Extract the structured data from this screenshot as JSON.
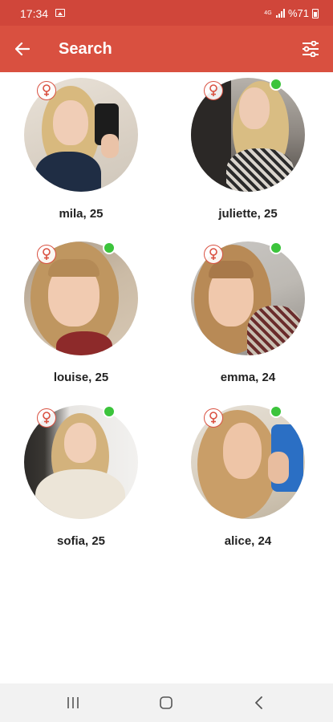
{
  "status_bar": {
    "time": "17:34",
    "network": "4G",
    "battery_text": "%71",
    "icons": [
      "image-icon",
      "signal-icon",
      "battery-icon"
    ]
  },
  "app_bar": {
    "title": "Search",
    "back_icon": "arrow-left-icon",
    "filter_icon": "sliders-icon",
    "color": "#d95040"
  },
  "profiles": [
    {
      "name": "mila, 25",
      "online": false,
      "gender_icon": "female-icon"
    },
    {
      "name": "juliette, 25",
      "online": true,
      "gender_icon": "female-icon"
    },
    {
      "name": "louise, 25",
      "online": true,
      "gender_icon": "female-icon"
    },
    {
      "name": "emma, 24",
      "online": true,
      "gender_icon": "female-icon"
    },
    {
      "name": "sofia, 25",
      "online": true,
      "gender_icon": "female-icon"
    },
    {
      "name": "alice, 24",
      "online": true,
      "gender_icon": "female-icon"
    }
  ],
  "colors": {
    "accent": "#d95040",
    "online": "#3cc43c"
  },
  "nav_bar": {
    "icons": [
      "recents-icon",
      "home-icon",
      "back-icon"
    ]
  }
}
